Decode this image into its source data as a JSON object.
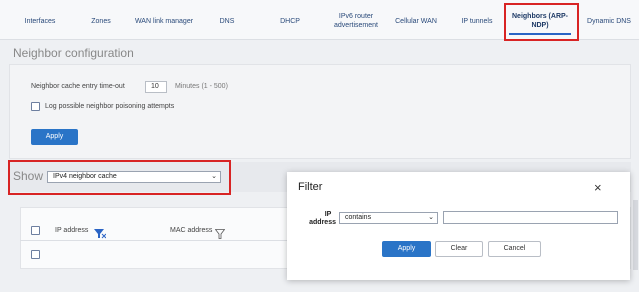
{
  "tabs": [
    {
      "label": "Interfaces"
    },
    {
      "label": "Zones"
    },
    {
      "label": "WAN link manager"
    },
    {
      "label": "DNS"
    },
    {
      "label": "DHCP"
    },
    {
      "label": "IPv6 router advertisement"
    },
    {
      "label": "Cellular WAN"
    },
    {
      "label": "IP tunnels"
    },
    {
      "label": "Neighbors (ARP-NDP)"
    },
    {
      "label": "Dynamic DNS"
    }
  ],
  "neighbor_config": {
    "title": "Neighbor configuration",
    "timeout_label": "Neighbor cache entry time-out",
    "timeout_value": "10",
    "timeout_hint": "Minutes (1 - 500)",
    "poison_checkbox_label": "Log possible neighbor poisoning attempts",
    "apply_label": "Apply"
  },
  "show": {
    "label": "Show",
    "selected": "IPv4 neighbor cache"
  },
  "table": {
    "columns": [
      "IP address",
      "MAC address"
    ]
  },
  "filter_dialog": {
    "title": "Filter",
    "field_label_line1": "IP",
    "field_label_line2": "address",
    "operator_selected": "contains",
    "value": "",
    "apply_label": "Apply",
    "clear_label": "Clear",
    "cancel_label": "Cancel",
    "close_glyph": "×"
  },
  "colors": {
    "accent": "#2a74c7",
    "highlight_border": "#d82424",
    "filter_active_icon": "#2a64c5"
  }
}
